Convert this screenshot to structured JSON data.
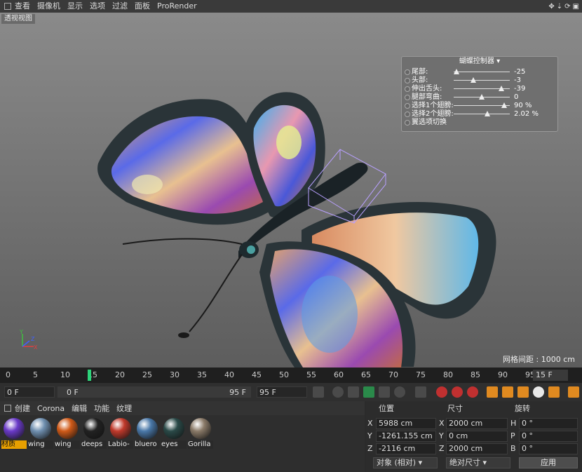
{
  "menu": [
    "查看",
    "摄像机",
    "显示",
    "选项",
    "过滤",
    "面板",
    "ProRender"
  ],
  "viewport": {
    "title": "透视视图",
    "grid_info": "网格间距 : 1000 cm",
    "axes": {
      "y": "Y",
      "x": "X",
      "z": "Z"
    }
  },
  "controller": {
    "title": "蝴蝶控制器",
    "rows": [
      {
        "label": "尾部:",
        "value": "-25",
        "pos": 0.05
      },
      {
        "label": "头部:",
        "value": "-3",
        "pos": 0.35
      },
      {
        "label": "伸出舌头:",
        "value": "-39",
        "pos": 0.85
      },
      {
        "label": "腿部弯曲:",
        "value": "0",
        "pos": 0.5
      },
      {
        "label": "选择1个翅膀:",
        "value": "90 %",
        "pos": 0.9
      },
      {
        "label": "选择2个翅膀:",
        "value": "2.02 %",
        "pos": 0.6
      },
      {
        "label": "翼选项切换",
        "value": "",
        "pos": null
      }
    ]
  },
  "timeline": {
    "ticks": [
      "0",
      "5",
      "10",
      "15",
      "20",
      "25",
      "30",
      "35",
      "40",
      "45",
      "50",
      "55",
      "60",
      "65",
      "70",
      "75",
      "80",
      "85",
      "90",
      "95"
    ],
    "current": "15",
    "frame_field": "15 F"
  },
  "controls": {
    "start": "0 F",
    "range_start": "0 F",
    "range_end": "95 F",
    "end": "95 F"
  },
  "material_menu": [
    "创建",
    "Corona",
    "编辑",
    "功能",
    "纹理"
  ],
  "materials": [
    {
      "name": "材质",
      "color": "#6a3ac8"
    },
    {
      "name": "wing",
      "color": "#7090b0"
    },
    {
      "name": "wing",
      "color": "#d05a18"
    },
    {
      "name": "deeps",
      "color": "#222222"
    },
    {
      "name": "Labio-",
      "color": "#c0392b"
    },
    {
      "name": "bluero",
      "color": "#4a78a8"
    },
    {
      "name": "eyes",
      "color": "#2a4a48"
    },
    {
      "name": "Gorilla",
      "color": "#8a7a68"
    }
  ],
  "attributes": {
    "headers": {
      "position": "位置",
      "size": "尺寸",
      "rotation": "旋转"
    },
    "rows": [
      {
        "pl": "X",
        "pv": "5988 cm",
        "sl": "X",
        "sv": "2000 cm",
        "rl": "H",
        "rv": "0 °"
      },
      {
        "pl": "Y",
        "pv": "-1261.155 cm",
        "sl": "Y",
        "sv": "0 cm",
        "rl": "P",
        "rv": "0 °"
      },
      {
        "pl": "Z",
        "pv": "-2116 cm",
        "sl": "Z",
        "sv": "2000 cm",
        "rl": "B",
        "rv": "0 °"
      }
    ],
    "mode_dropdown": "对象 (相对)",
    "size_dropdown": "绝对尺寸",
    "apply_label": "应用"
  }
}
